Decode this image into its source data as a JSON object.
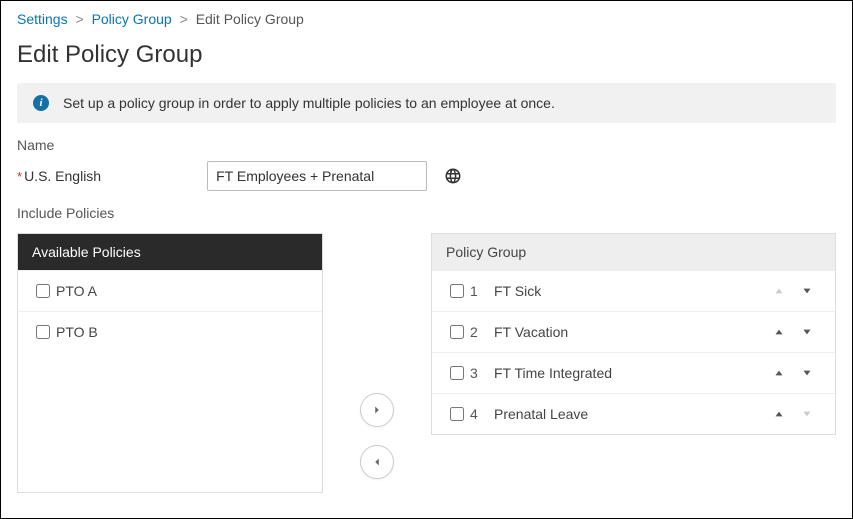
{
  "breadcrumb": {
    "settings": "Settings",
    "policy_group": "Policy Group",
    "current": "Edit Policy Group"
  },
  "page_title": "Edit Policy Group",
  "info_message": "Set up a policy group in order to apply multiple policies to an employee at once.",
  "form": {
    "name_label": "Name",
    "required_prefix": "*",
    "language_label": "U.S. English",
    "name_value": "FT Employees + Prenatal"
  },
  "include_label": "Include Policies",
  "available": {
    "header": "Available Policies",
    "items": [
      {
        "label": "PTO A"
      },
      {
        "label": "PTO B"
      }
    ]
  },
  "transfer": {
    "add": "add",
    "remove": "remove"
  },
  "group": {
    "header": "Policy Group",
    "items": [
      {
        "index": "1",
        "label": "FT Sick",
        "up_enabled": false,
        "down_enabled": true
      },
      {
        "index": "2",
        "label": "FT Vacation",
        "up_enabled": true,
        "down_enabled": true
      },
      {
        "index": "3",
        "label": "FT Time Integrated",
        "up_enabled": true,
        "down_enabled": true
      },
      {
        "index": "4",
        "label": "Prenatal Leave",
        "up_enabled": true,
        "down_enabled": false
      }
    ]
  }
}
